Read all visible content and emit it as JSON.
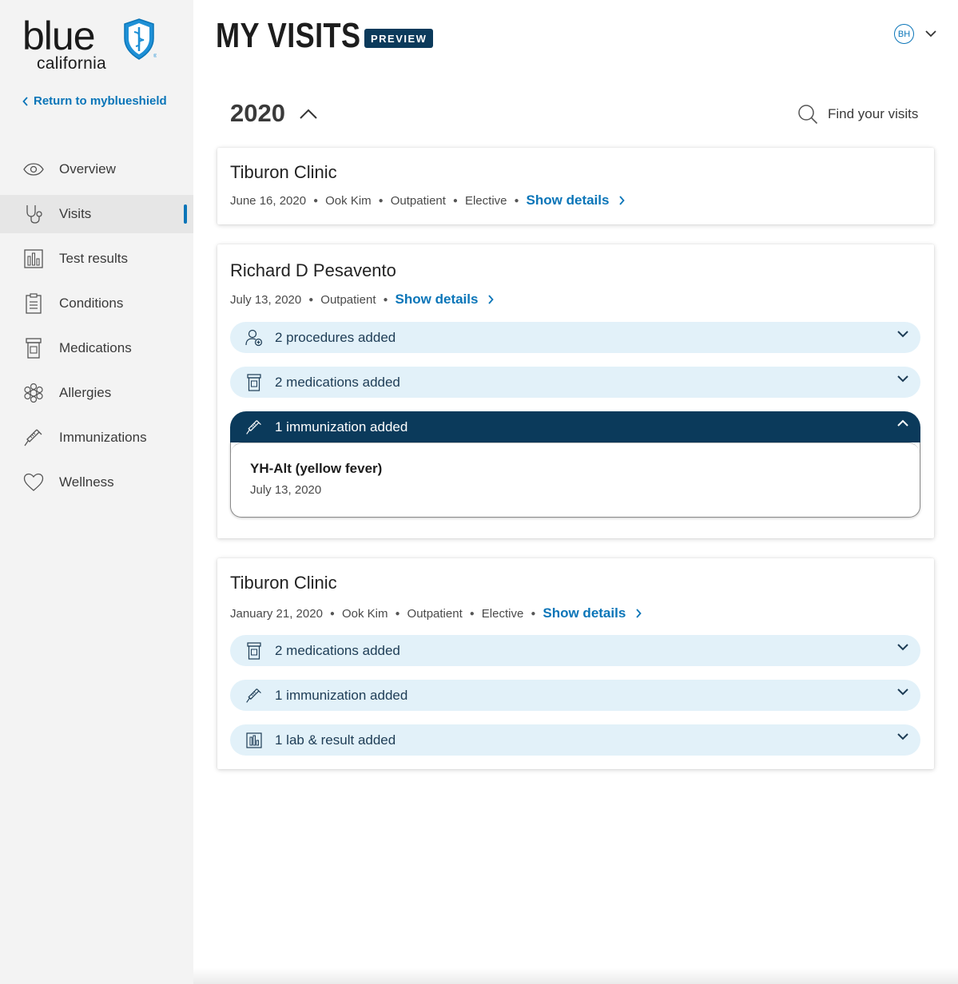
{
  "brand": {
    "logo_word": "blue",
    "logo_sub": "california"
  },
  "sidebar": {
    "return_label": "Return to myblueshield",
    "items": [
      {
        "label": "Overview",
        "icon": "eye-icon"
      },
      {
        "label": "Visits",
        "icon": "stethoscope-icon",
        "active": true
      },
      {
        "label": "Test results",
        "icon": "bar-chart-icon"
      },
      {
        "label": "Conditions",
        "icon": "clipboard-icon"
      },
      {
        "label": "Medications",
        "icon": "pill-bottle-icon"
      },
      {
        "label": "Allergies",
        "icon": "allergy-icon"
      },
      {
        "label": "Immunizations",
        "icon": "syringe-icon"
      },
      {
        "label": "Wellness",
        "icon": "heart-icon"
      }
    ]
  },
  "header": {
    "title": "MY VISITS",
    "badge": "PREVIEW",
    "user_initials": "BH"
  },
  "year": {
    "label": "2020"
  },
  "search": {
    "label": "Find your visits"
  },
  "visits": [
    {
      "title": "Tiburon Clinic",
      "meta": [
        "June 16, 2020",
        "Ook Kim",
        "Outpatient",
        "Elective"
      ],
      "show_details": "Show details"
    },
    {
      "title": "Richard D Pesavento",
      "meta": [
        "July 13, 2020",
        "Outpatient"
      ],
      "show_details": "Show details",
      "sections": [
        {
          "label": "2 procedures added",
          "icon": "procedure-icon"
        },
        {
          "label": "2 medications added",
          "icon": "pill-bottle-icon"
        },
        {
          "label": "1 immunization added",
          "icon": "syringe-icon",
          "expanded": true,
          "entries": [
            {
              "name": "YH-Alt (yellow fever)",
              "date": "July 13, 2020"
            }
          ]
        }
      ]
    },
    {
      "title": "Tiburon Clinic",
      "meta": [
        "January 21, 2020",
        "Ook Kim",
        "Outpatient",
        "Elective"
      ],
      "show_details": "Show details",
      "sections": [
        {
          "label": "2 medications added",
          "icon": "pill-bottle-icon"
        },
        {
          "label": "1 immunization added",
          "icon": "syringe-icon"
        },
        {
          "label": "1 lab & result added",
          "icon": "lab-result-icon"
        }
      ]
    }
  ],
  "colors": {
    "accent": "#0a75b8",
    "navy": "#0b3a5b",
    "pill_bg": "#e2f1f9",
    "sidebar_bg": "#f3f3f3"
  }
}
